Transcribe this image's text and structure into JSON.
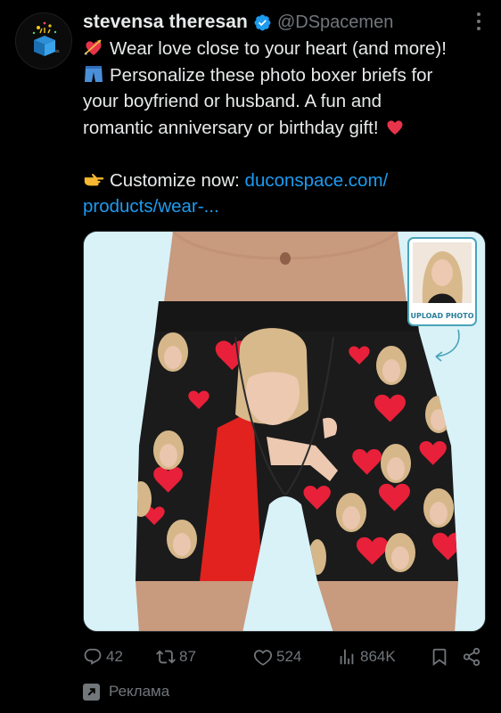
{
  "post": {
    "author_name": "stevensa theresan",
    "handle": "@DSpacemen",
    "text_lines": [
      "Wear love close to your heart (and more)!",
      "Personalize these photo boxer briefs for",
      "your boyfriend or husband. A fun and",
      "romantic anniversary or birthday gift!"
    ],
    "cta_prefix": "Customize now:",
    "link_line1": "duconspace.com/",
    "link_line2": "products/wear-..."
  },
  "media": {
    "upload_label": "UPLOAD PHOTO"
  },
  "metrics": {
    "replies": "42",
    "reposts": "87",
    "likes": "524",
    "views": "864K"
  },
  "promoted_label": "Реклама",
  "colors": {
    "background": "#000000",
    "text": "#e7e9ea",
    "muted": "#71767b",
    "link": "#1d9bf0",
    "verified": "#1d9bf0"
  },
  "icons": [
    "more-icon",
    "verified-badge-icon",
    "reply-icon",
    "repost-icon",
    "like-icon",
    "views-icon",
    "bookmark-icon",
    "share-icon",
    "promoted-icon"
  ]
}
